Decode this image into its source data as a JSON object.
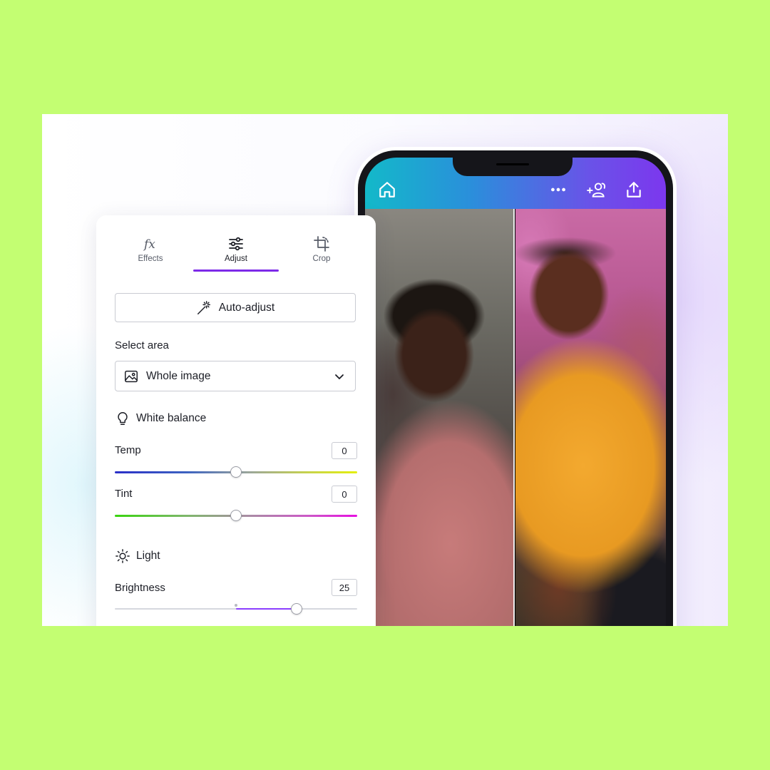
{
  "tabs": [
    {
      "label": "Effects",
      "icon": "fx-icon"
    },
    {
      "label": "Adjust",
      "icon": "sliders-icon"
    },
    {
      "label": "Crop",
      "icon": "crop-icon"
    }
  ],
  "active_tab": "Adjust",
  "auto_adjust": {
    "label": "Auto-adjust",
    "icon": "magic-wand-icon"
  },
  "select_area": {
    "label": "Select area",
    "value": "Whole image",
    "icon": "image-icon"
  },
  "white_balance": {
    "title": "White balance",
    "icon": "lightbulb-icon",
    "temp": {
      "label": "Temp",
      "value": "0",
      "level": 0.5
    },
    "tint": {
      "label": "Tint",
      "value": "0",
      "level": 0.5
    }
  },
  "light": {
    "title": "Light",
    "icon": "sun-icon",
    "brightness": {
      "label": "Brightness",
      "value": "25",
      "level": 0.75
    }
  },
  "phone_appbar": {
    "icons": [
      "home-icon",
      "more-icon",
      "add-people-icon",
      "share-icon"
    ]
  },
  "colors": {
    "background": "#c3fe72",
    "accent": "#7d2ae8",
    "appbar_start": "#13b9c9",
    "appbar_end": "#7c37ee"
  }
}
